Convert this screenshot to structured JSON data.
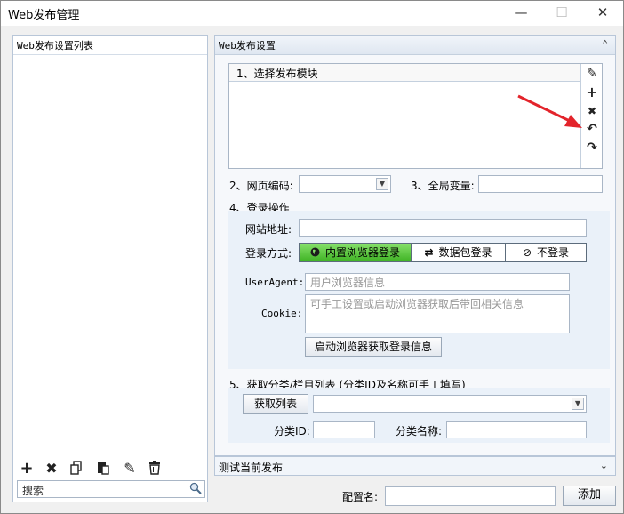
{
  "window": {
    "title": "Web发布管理",
    "min": "—",
    "max": "☐",
    "close": "✕"
  },
  "left_panel": {
    "header": "Web发布设置列表",
    "search_placeholder": "搜索"
  },
  "right_panel": {
    "header": "Web发布设置",
    "module": {
      "label": "1、选择发布模块"
    },
    "encoding": {
      "label": "2、网页编码:",
      "value": ""
    },
    "global_var": {
      "label": "3、全局变量:",
      "value": ""
    },
    "login": {
      "section": "4、登录操作",
      "site_label": "网站地址:",
      "site_value": "",
      "method_label": "登录方式:",
      "methods": [
        "内置浏览器登录",
        "数据包登录",
        "不登录"
      ],
      "useragent_label": "UserAgent:",
      "useragent_placeholder": "用户浏览器信息",
      "cookie_label": "Cookie:",
      "cookie_placeholder": "可手工设置或启动浏览器获取后带回相关信息",
      "launch_button": "启动浏览器获取登录信息"
    },
    "category": {
      "section": "5、获取分类/栏目列表 (分类ID及名称可手工填写)",
      "fetch_button": "获取列表",
      "id_label": "分类ID:",
      "name_label": "分类名称:"
    }
  },
  "test_bar": {
    "label": "测试当前发布"
  },
  "footer": {
    "config_label": "配置名:",
    "config_value": "",
    "add_button": "添加"
  },
  "colors": {
    "active_segment": "#54c73a",
    "arrow": "#e3242b"
  }
}
